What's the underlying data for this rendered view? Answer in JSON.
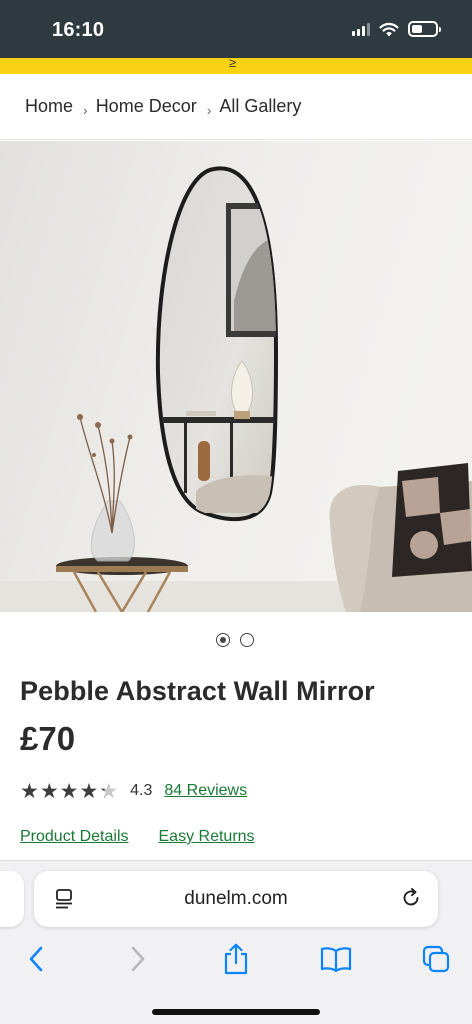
{
  "status_bar": {
    "time": "16:10",
    "icons": [
      "cellular-signal-icon",
      "wifi-icon",
      "battery-icon"
    ]
  },
  "promo_band": {
    "glyph": "≥",
    "color": "#f8d112"
  },
  "breadcrumb": {
    "items": [
      "Home",
      "Home Decor",
      "All Gallery"
    ],
    "separator": "›"
  },
  "carousel": {
    "total": 2,
    "active_index": 0
  },
  "product": {
    "title": "Pebble Abstract Wall Mirror",
    "price": "£70",
    "rating_value": "4.3",
    "rating_stars": 4.3,
    "reviews_label": "84 Reviews",
    "links": {
      "details": "Product Details",
      "returns": "Easy Returns"
    }
  },
  "browser": {
    "url": "dunelm.com",
    "toolbar_icons": [
      "back-icon",
      "forward-icon",
      "share-icon",
      "bookmarks-icon",
      "tabs-icon"
    ]
  },
  "colors": {
    "status_bar_bg": "#2f3a40",
    "link_green": "#1a7a35",
    "ios_blue": "#0a84ff"
  }
}
